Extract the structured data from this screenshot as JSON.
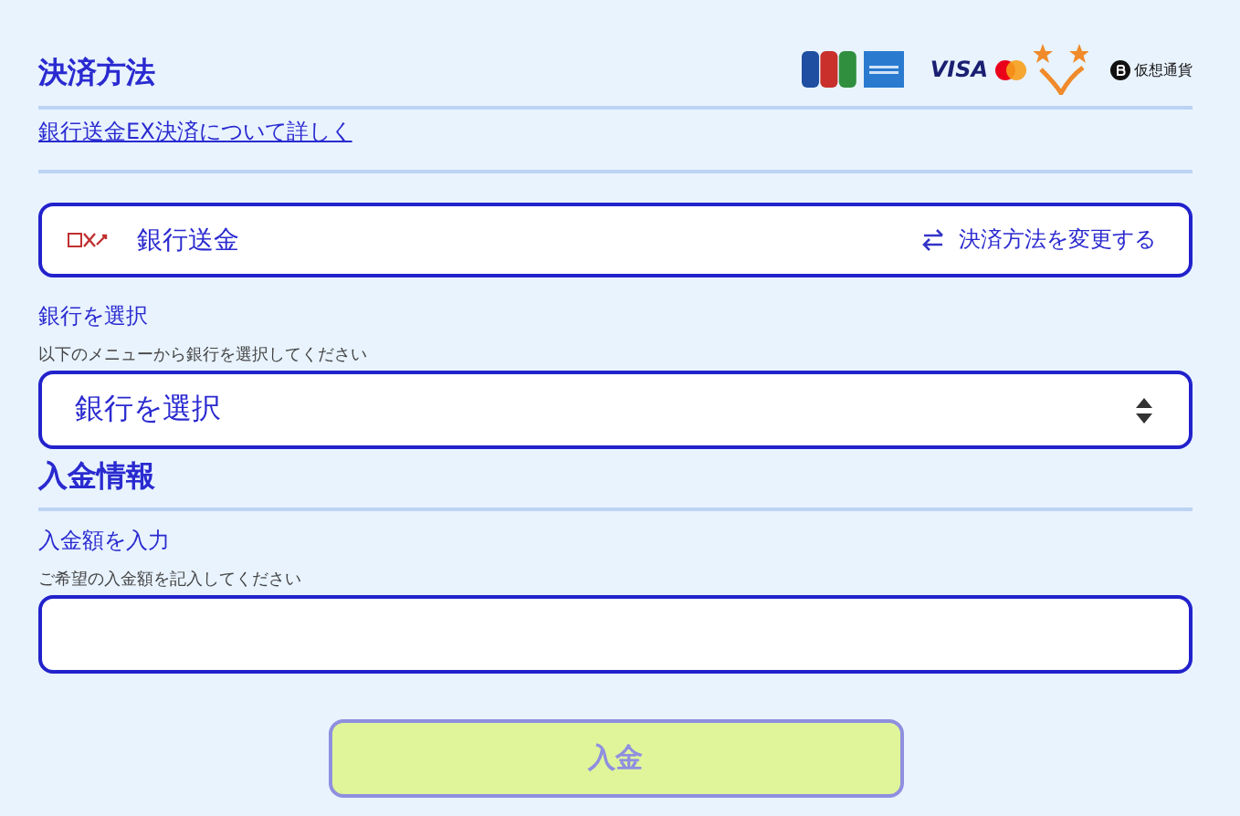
{
  "payment_section": {
    "title": "決済方法",
    "brands": [
      {
        "kind": "jcb"
      },
      {
        "kind": "amex"
      },
      {
        "kind": "visa",
        "label": "VISA"
      },
      {
        "kind": "mastercard"
      },
      {
        "kind": "stars"
      },
      {
        "kind": "crypto",
        "label": "仮想通貨"
      }
    ],
    "details_link": "銀行送金EX決済について詳しく"
  },
  "method": {
    "name": "銀行送金",
    "change_link": "決済方法を変更する"
  },
  "bank_select": {
    "label": "銀行を選択",
    "hint": "以下のメニューから銀行を選択してください",
    "value": "銀行を選択"
  },
  "deposit_section": {
    "title": "入金情報",
    "label": "入金額を入力",
    "hint": "ご希望の入金額を記入してください"
  },
  "submit_button": {
    "label": "入金",
    "disabled": true
  }
}
